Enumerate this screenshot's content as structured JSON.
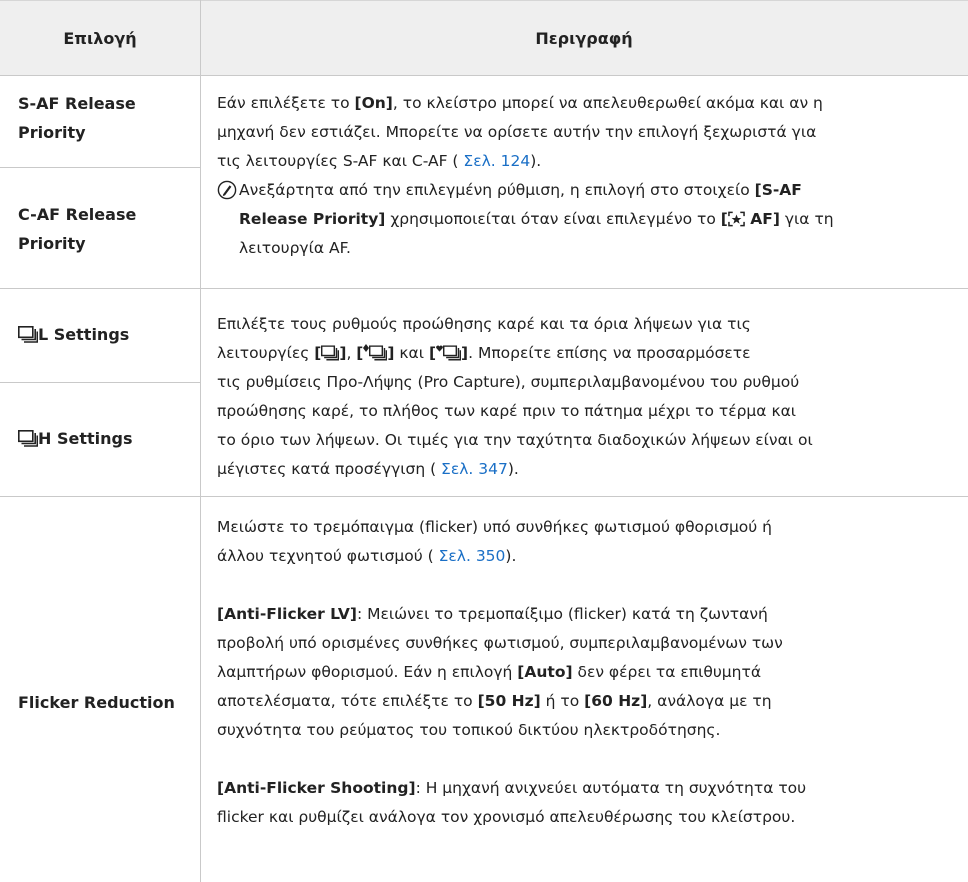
{
  "header": {
    "col_option": "Επιλογή",
    "col_description": "Περιγραφή"
  },
  "rows": {
    "saf_label_1": "S-AF Release",
    "saf_label_2": "Priority",
    "caf_label_1": "C-AF Release",
    "caf_label_2": "Priority",
    "release_desc": {
      "t1": "Εάν επιλέξετε το ",
      "b1": "[On]",
      "t2": ", το κλείστρο μπορεί να απελευθερωθεί ακόμα και αν η",
      "t3": "μηχανή δεν εστιάζει. Μπορείτε να ορίσετε αυτήν την επιλογή ξεχωριστά για",
      "t4": "τις λειτουργίες S-AF και C-AF ( ",
      "link": "Σελ. 124",
      "t5": ").",
      "note_t1": "Ανεξάρτητα από την επιλεγμένη ρύθμιση, η επιλογή στο στοιχείο ",
      "note_b1": "[S-AF",
      "note_b2": "Release Priority]",
      "note_t2": " χρησιμοποιείται όταν είναι επιλεγμένο το ",
      "note_b3_open": "[",
      "note_b3_close": " AF]",
      "note_t3": " για τη",
      "note_t4": "λειτουργία AF."
    },
    "l_settings_label": "L Settings",
    "h_settings_label": "H Settings",
    "sequential_desc": {
      "t1": "Επιλέξτε τους ρυθμούς προώθησης καρέ και τα όρια λήψεων για τις",
      "t2": "λειτουργίες ",
      "b_open1": "[",
      "b_close1": "]",
      "t3": ", ",
      "b_open2": "[",
      "b_close2": "]",
      "t4": " και ",
      "b_open3": "[",
      "b_close3": "]",
      "t5": ". Μπορείτε επίσης να προσαρμόσετε",
      "t6": "τις ρυθμίσεις Προ-Λήψης (Pro Capture), συμπεριλαμβανομένου του ρυθμού",
      "t7": "προώθησης καρέ, το πλήθος των καρέ πριν το πάτημα μέχρι το τέρμα και",
      "t8": "το όριο των λήψεων. Οι τιμές για την ταχύτητα διαδοχικών λήψεων είναι οι",
      "t9": "μέγιστες κατά προσέγγιση ( ",
      "link": "Σελ. 347",
      "t10": ")."
    },
    "flicker_label": "Flicker Reduction",
    "flicker_desc": {
      "p1_t1": "Μειώστε το τρεμόπαιγμα (flicker) υπό συνθήκες φωτισμού φθορισμού ή",
      "p1_t2": "άλλου τεχνητού φωτισμού ( ",
      "p1_link": "Σελ. 350",
      "p1_t3": ").",
      "p2_b1": "[Anti-Flicker LV]",
      "p2_t1": ": Μειώνει το τρεμοπαίξιμο (flicker) κατά τη ζωντανή",
      "p2_t2": "προβολή υπό ορισμένες συνθήκες φωτισμού, συμπεριλαμβανομένων των",
      "p2_t3": "λαμπτήρων φθορισμού. Εάν η επιλογή ",
      "p2_b2": "[Auto]",
      "p2_t4": " δεν φέρει τα επιθυμητά",
      "p2_t5": "αποτελέσματα, τότε επιλέξτε το ",
      "p2_b3": "[50 Hz]",
      "p2_t6": " ή το ",
      "p2_b4": "[60 Hz]",
      "p2_t7": ", ανάλογα με τη",
      "p2_t8": "συχνότητα του ρεύματος του τοπικού δικτύου ηλεκτροδότησης.",
      "p3_b1": "[Anti-Flicker Shooting]",
      "p3_t1": ": Η μηχανή ανιχνεύει αυτόματα τη συχνότητα του",
      "p3_t2": "flicker και ρυθμίζει ανάλογα τον χρονισμό απελευθέρωσης του κλείστρου."
    }
  },
  "icons": {
    "note": "note-pen-icon",
    "sequential": "sequential-shooting-icon",
    "face_priority": "face-priority-af-icon"
  },
  "colors": {
    "header_bg": "#efefef",
    "grid": "#c9c9c9",
    "link": "#1a6fc6",
    "text": "#222222"
  }
}
